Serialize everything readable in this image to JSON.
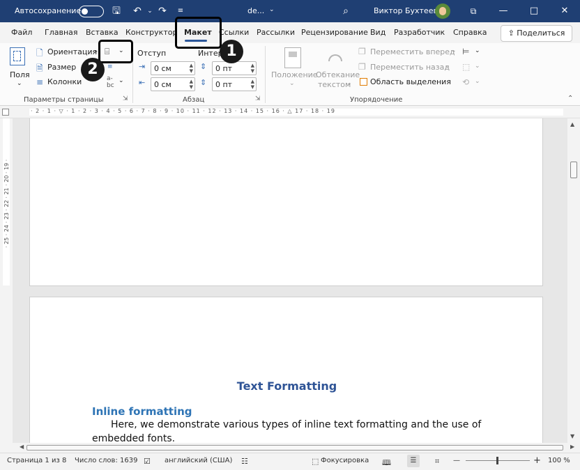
{
  "titlebar": {
    "autosave_label": "Автосохранение",
    "doc_name": "de...",
    "user_name": "Виктор Бухтеев"
  },
  "tabs": [
    {
      "label": "Файл"
    },
    {
      "label": "Главная"
    },
    {
      "label": "Вставка"
    },
    {
      "label": "Конструктор"
    },
    {
      "label": "Макет",
      "active": true
    },
    {
      "label": "Ссылки"
    },
    {
      "label": "Рассылки"
    },
    {
      "label": "Рецензирование"
    },
    {
      "label": "Вид"
    },
    {
      "label": "Разработчик"
    },
    {
      "label": "Справка"
    }
  ],
  "share_label": "Поделиться",
  "ribbon": {
    "page_setup": {
      "margins": "Поля",
      "orientation": "Ориентация",
      "size": "Размер",
      "columns": "Колонки",
      "group_label": "Параметры страницы"
    },
    "paragraph": {
      "indent_label": "Отступ",
      "spacing_label": "Интервал",
      "indent_left": "0 см",
      "indent_right": "0 см",
      "spacing_before": "0 пт",
      "spacing_after": "0 пт",
      "group_label": "Абзац"
    },
    "arrange": {
      "position": "Положение",
      "wrap_text_1": "Обтекание",
      "wrap_text_2": "текстом",
      "bring_forward": "Переместить вперед",
      "send_backward": "Переместить назад",
      "selection_pane": "Область выделения",
      "group_label": "Упорядочение"
    }
  },
  "callouts": [
    "1",
    "2"
  ],
  "rulers": {
    "horizontal_ticks": "· 2 · 1 · ▽ · 1 · 2 · 3 · 4 · 5 · 6 · 7 · 8 · 9 · 10 · 11 · 12 · 13 · 14 · 15 · 16 · △ 17 · 18 · 19",
    "vertical_ticks": "· 25 · 24 · 23 · 22 · 21 · 20 · 19 ·"
  },
  "document": {
    "heading": "Text Formatting",
    "subheading": "Inline formatting",
    "body_line1": "Here, we demonstrate various types of inline text formatting and the use of",
    "body_line2": "embedded fonts."
  },
  "status": {
    "page": "Страница 1 из 8",
    "words": "Число слов: 1639",
    "language": "английский (США)",
    "focus": "Фокусировка",
    "zoom": "100 %"
  },
  "colors": {
    "titlebar": "#1f3f73",
    "accent": "#2b579a",
    "heading": "#2f5496"
  }
}
